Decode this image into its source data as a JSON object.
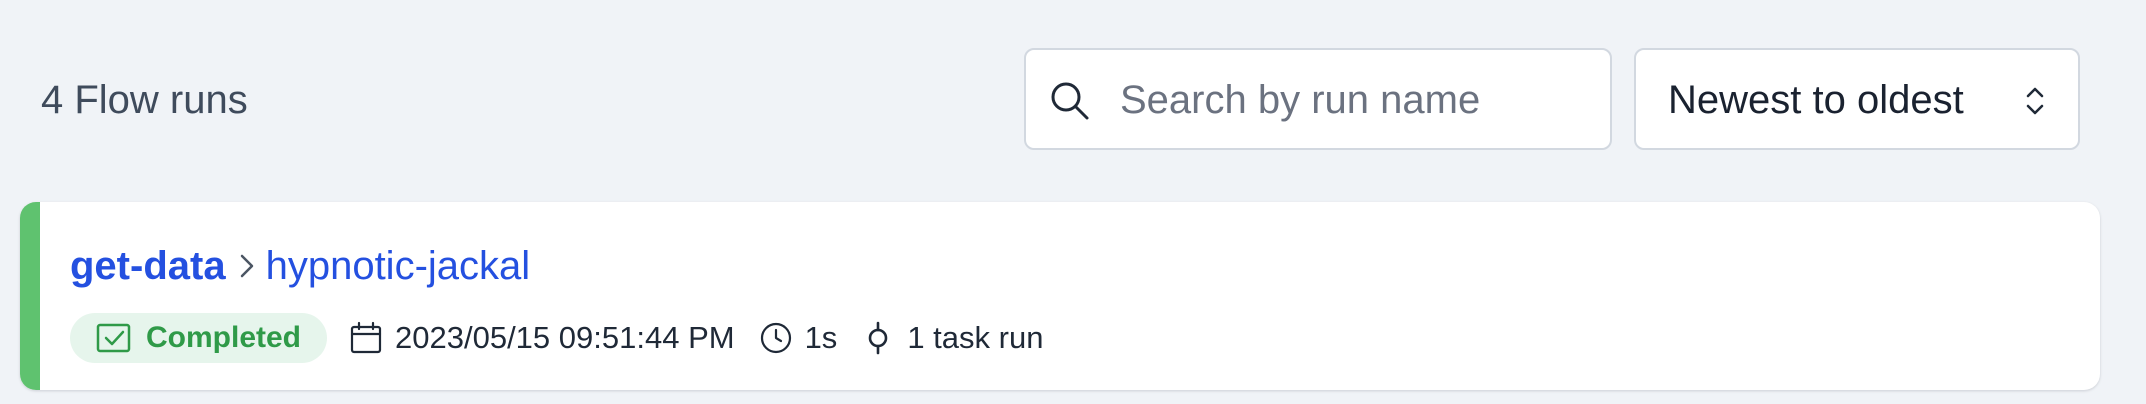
{
  "header": {
    "run_count": "4 Flow runs"
  },
  "search": {
    "placeholder": "Search by run name",
    "value": "",
    "icon": "search-icon"
  },
  "sort": {
    "selected": "Newest to oldest",
    "icon": "chevron-up-down-icon"
  },
  "runs": [
    {
      "flow_name": "get-data",
      "run_name": "hypnotic-jackal",
      "state": "Completed",
      "state_icon": "check-square-icon",
      "start_time": "2023/05/15 09:51:44 PM",
      "duration": "1s",
      "task_runs": "1 task run"
    }
  ],
  "colors": {
    "background": "#f0f3f7",
    "link": "#2450e0",
    "completed_stripe": "#5fc26f",
    "completed_badge_bg": "#e6f5ec",
    "completed_badge_text": "#2f9a48"
  }
}
